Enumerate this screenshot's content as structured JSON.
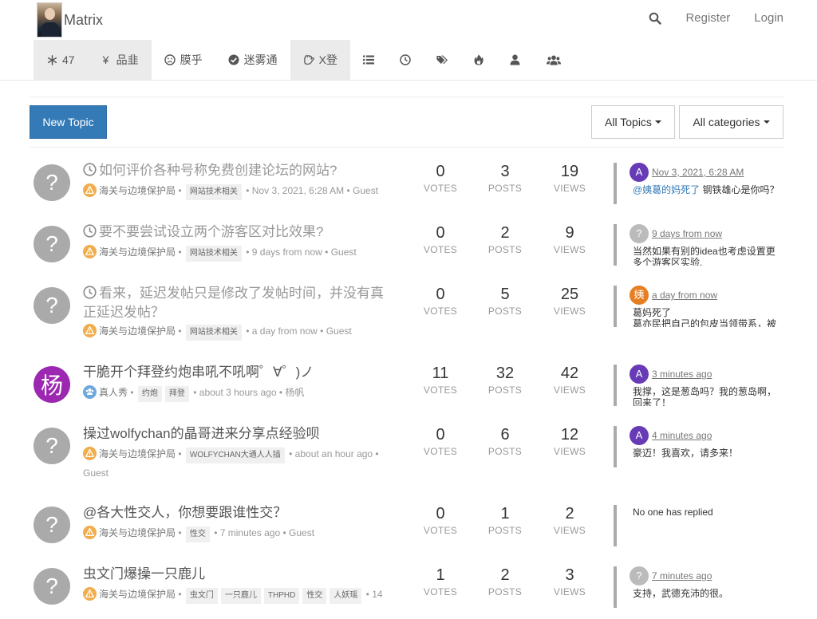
{
  "brand": {
    "name": "Matrix"
  },
  "header": {
    "register": "Register",
    "login": "Login"
  },
  "nav": [
    {
      "label": "47",
      "icon": "snowflake-icon"
    },
    {
      "label": "品韭",
      "icon": "yen-icon"
    },
    {
      "label": "膜乎",
      "icon": "frown-icon"
    },
    {
      "label": "迷雾通",
      "icon": "check-circle-icon"
    },
    {
      "label": "X登",
      "icon": "hand-icon"
    }
  ],
  "toolbar": {
    "new_topic": "New Topic",
    "all_topics": "All Topics",
    "all_categories": "All categories"
  },
  "labels": {
    "votes": "VOTES",
    "posts": "POSTS",
    "views": "VIEWS"
  },
  "topics": [
    {
      "title": "如何评价各种号称免费创建论坛的网站?",
      "scheduled": true,
      "avatar": "?",
      "category": "海关与边境保护局",
      "tags": [
        "网站技术相关"
      ],
      "time": "Nov 3, 2021, 6:28 AM",
      "author": "Guest",
      "votes": "0",
      "posts": "3",
      "views": "19",
      "teaser": {
        "avatar": "A",
        "avatar_color": "#673ab7",
        "time": "Nov 3, 2021, 6:28 AM",
        "mention": "@姨葛的妈死了",
        "content": "钢铁雄心是你吗？"
      }
    },
    {
      "title": "要不要尝试设立两个游客区对比效果?",
      "scheduled": true,
      "avatar": "?",
      "category": "海关与边境保护局",
      "tags": [
        "网站技术相关"
      ],
      "time": "9 days from now",
      "author": "Guest",
      "votes": "0",
      "posts": "2",
      "views": "9",
      "teaser": {
        "avatar": "?",
        "avatar_color": "#bbbbbb",
        "time": "9 days from now",
        "mention": "",
        "content": "当然如果有别的idea也考虑设置更多个游客区实验."
      }
    },
    {
      "title": "看来，延迟发帖只是修改了发帖时间，并没有真正延迟发帖？",
      "scheduled": true,
      "avatar": "?",
      "category": "海关与边境保护局",
      "tags": [
        "网站技术相关"
      ],
      "time": "a day from now",
      "author": "Guest",
      "votes": "0",
      "posts": "5",
      "views": "25",
      "teaser": {
        "avatar": "姨",
        "avatar_color": "#e67e22",
        "time": "a day from now",
        "mention": "",
        "content": "葛妈死了\n葛亦民把自己的包皮当领带系，被"
      }
    },
    {
      "title": "干脆开个拜登约炮串吼不吼啊゜∀゜)ノ",
      "scheduled": false,
      "avatar": "杨",
      "avatar_color": "#9c27b0",
      "category": "真人秀",
      "tags": [
        "约炮",
        "拜登"
      ],
      "time": "about 3 hours ago",
      "author": "杨帆",
      "votes": "11",
      "posts": "32",
      "views": "42",
      "teaser": {
        "avatar": "A",
        "avatar_color": "#673ab7",
        "time": "3 minutes ago",
        "mention": "",
        "content": "我撑，这是葱岛吗？我的葱岛啊，回来了！"
      }
    },
    {
      "title": "操过wolfychan的晶哥进来分享点经验呗",
      "scheduled": false,
      "avatar": "?",
      "category": "海关与边境保护局",
      "tags": [
        "WOLFYCHAN大通人人插"
      ],
      "time": "about an hour ago",
      "author": "Guest",
      "votes": "0",
      "posts": "6",
      "views": "12",
      "teaser": {
        "avatar": "A",
        "avatar_color": "#673ab7",
        "time": "4 minutes ago",
        "mention": "",
        "content": "豪迈！我喜欢，请多来！"
      }
    },
    {
      "title": "@各大性交人，你想要跟谁性交？",
      "scheduled": false,
      "avatar": "?",
      "category": "海关与边境保护局",
      "tags": [
        "性交"
      ],
      "time": "7 minutes ago",
      "author": "Guest",
      "votes": "0",
      "posts": "1",
      "views": "2",
      "teaser": {
        "avatar": "",
        "avatar_color": "",
        "time": "",
        "mention": "",
        "content": "No one has replied"
      }
    },
    {
      "title": "虫文门爆操一只鹿儿",
      "scheduled": false,
      "avatar": "?",
      "category": "海关与边境保护局",
      "tags": [
        "虫文门",
        "一只鹿儿",
        "THPHD",
        "性交",
        "人妖瑶"
      ],
      "time": "",
      "author": "",
      "extra": "14",
      "votes": "1",
      "posts": "2",
      "views": "3",
      "teaser": {
        "avatar": "?",
        "avatar_color": "#bbbbbb",
        "time": "7 minutes ago",
        "mention": "",
        "content": "支持，武德充沛的很。"
      }
    }
  ],
  "colors": {
    "primary": "#337ab7",
    "category_icon": "#f0ad4e",
    "people_icon": "#6fa8dc"
  }
}
